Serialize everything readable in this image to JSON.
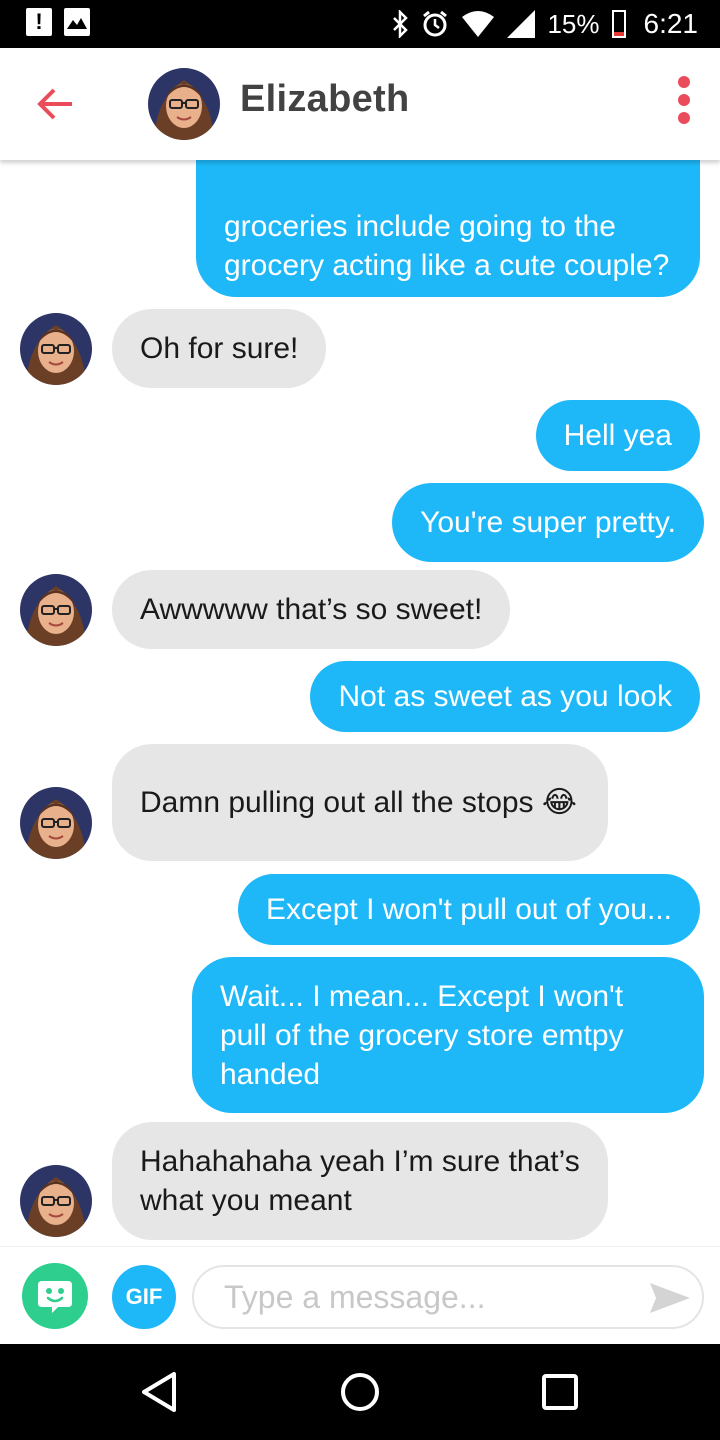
{
  "status_bar": {
    "battery": "15%",
    "battery_level": 0.15,
    "time": "6:21",
    "icons": [
      "alert-icon",
      "image-icon",
      "bluetooth-icon",
      "alarm-icon",
      "wifi-icon",
      "signal-icon",
      "battery-icon"
    ]
  },
  "header": {
    "contact_name": "Elizabeth",
    "back_icon": "back-arrow-icon",
    "menu_icon": "more-vertical-icon"
  },
  "messages": [
    {
      "type": "sent",
      "text": "groceries include going to the grocery acting like a cute couple?"
    },
    {
      "type": "received",
      "text": "Oh for sure!"
    },
    {
      "type": "sent",
      "text": "Hell yea"
    },
    {
      "type": "sent",
      "text": "You're super pretty."
    },
    {
      "type": "received",
      "text": "Awwwww that’s so sweet!"
    },
    {
      "type": "sent",
      "text": "Not as sweet as you look"
    },
    {
      "type": "received",
      "text": "Damn pulling out all the stops 😂"
    },
    {
      "type": "sent",
      "text": "Except I won't pull out of you..."
    },
    {
      "type": "sent",
      "text": "Wait... I mean... Except I won't pull of the grocery store emtpy handed"
    },
    {
      "type": "received",
      "text": "Hahahahaha yeah I’m sure that’s what you meant"
    }
  ],
  "input_bar": {
    "gif_label": "GIF",
    "placeholder": "Type a message...",
    "value": ""
  },
  "colors": {
    "sent_bubble": "#1eb8f8",
    "received_bubble": "#e6e6e6",
    "accent": "#ea4c5b",
    "sticker": "#2ecf8e"
  }
}
